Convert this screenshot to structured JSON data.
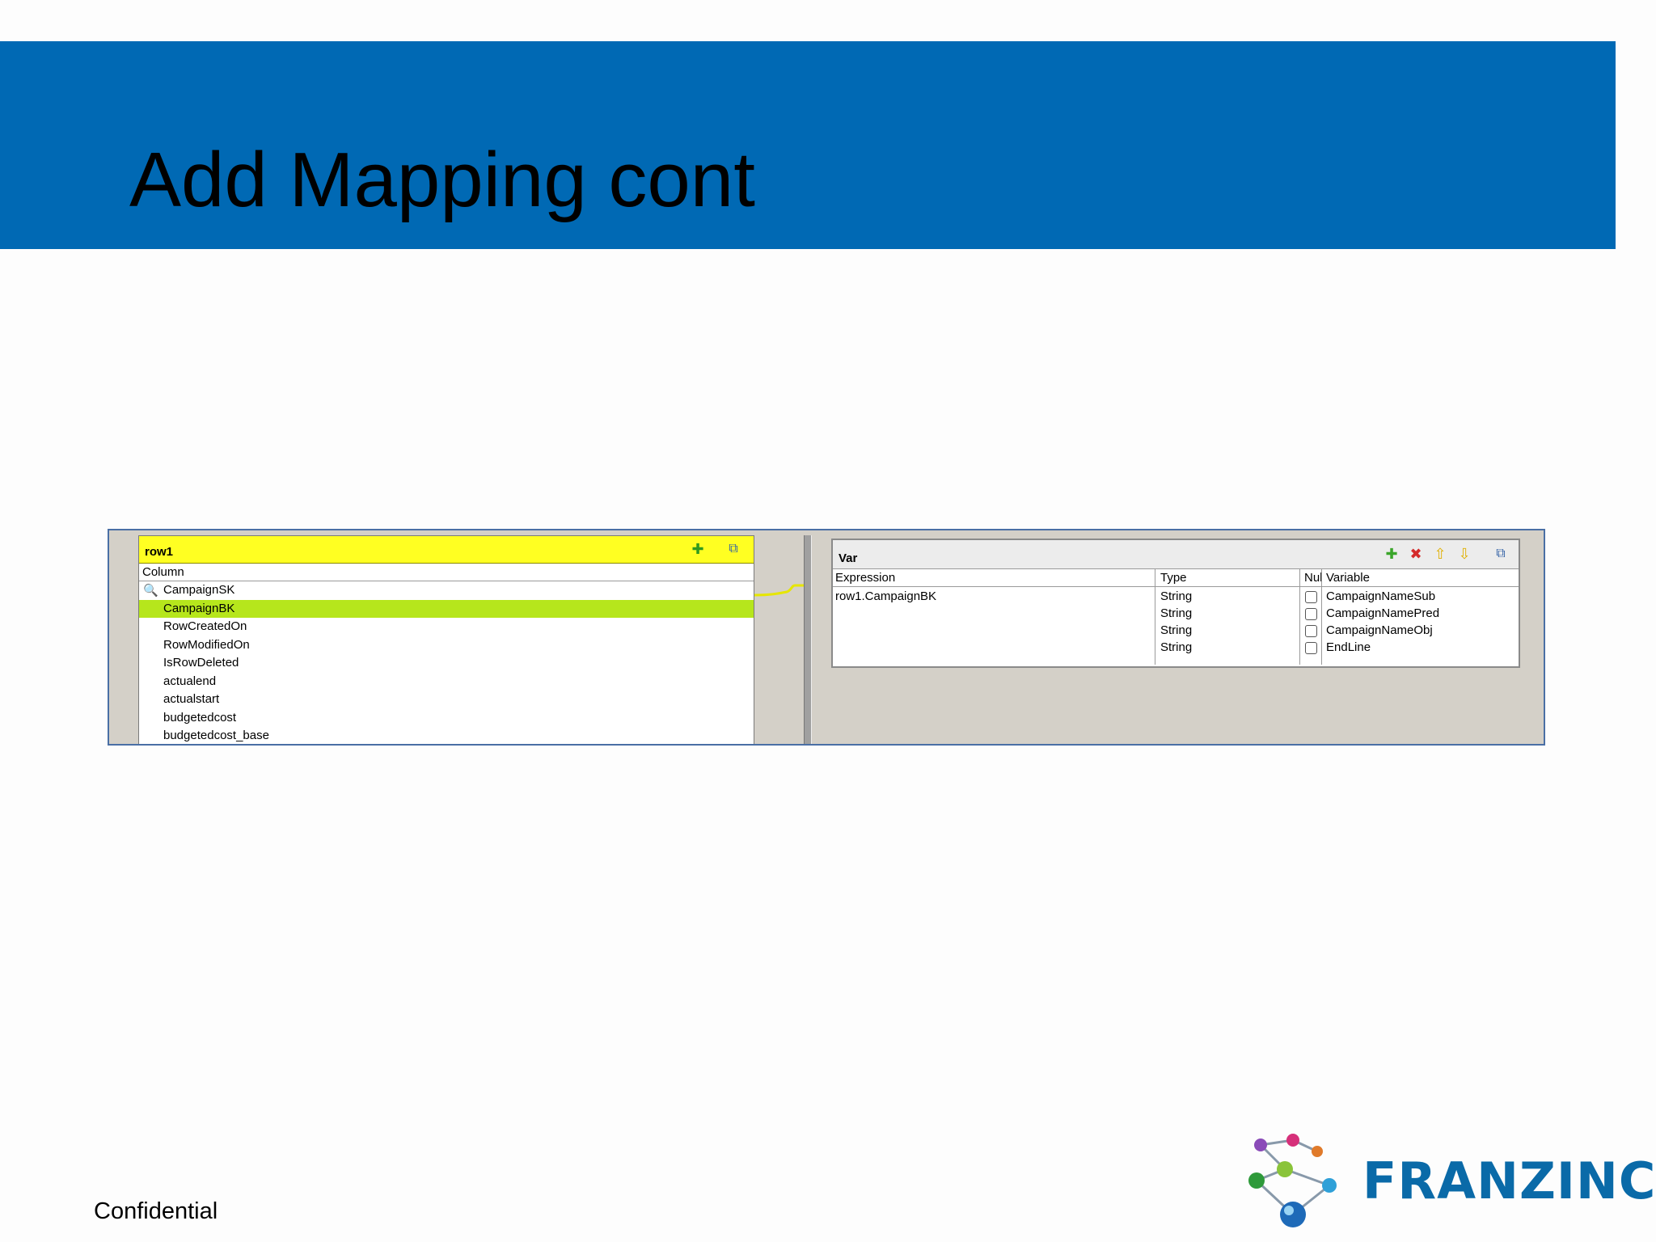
{
  "slide": {
    "title": "Add Mapping cont",
    "footer": "Confidential",
    "colors": {
      "banner": "#0069b4",
      "row_header": "#ffff22",
      "selected_row": "#b6e61c"
    }
  },
  "input_table": {
    "name": "row1",
    "column_header": "Column",
    "rows": [
      {
        "label": "CampaignSK",
        "key": true,
        "selected": false
      },
      {
        "label": "CampaignBK",
        "key": false,
        "selected": true
      },
      {
        "label": "RowCreatedOn",
        "key": false,
        "selected": false
      },
      {
        "label": "RowModifiedOn",
        "key": false,
        "selected": false
      },
      {
        "label": "IsRowDeleted",
        "key": false,
        "selected": false
      },
      {
        "label": "actualend",
        "key": false,
        "selected": false
      },
      {
        "label": "actualstart",
        "key": false,
        "selected": false
      },
      {
        "label": "budgetedcost",
        "key": false,
        "selected": false
      },
      {
        "label": "budgetedcost_base",
        "key": false,
        "selected": false
      }
    ],
    "toolbar_icons": [
      "add-icon",
      "expand-window-icon"
    ]
  },
  "var_table": {
    "name": "Var",
    "headers": {
      "expression": "Expression",
      "type": "Type",
      "nullable": "Nul",
      "variable": "Variable"
    },
    "rows": [
      {
        "expression": "row1.CampaignBK",
        "type": "String",
        "nullable": false,
        "variable": "CampaignNameSub"
      },
      {
        "expression": "",
        "type": "String",
        "nullable": false,
        "variable": "CampaignNamePred"
      },
      {
        "expression": "",
        "type": "String",
        "nullable": false,
        "variable": "CampaignNameObj"
      },
      {
        "expression": "",
        "type": "String",
        "nullable": false,
        "variable": "EndLine"
      }
    ],
    "toolbar_icons": [
      "plus-icon",
      "delete-icon",
      "arrow-up-icon",
      "arrow-down-icon",
      "expand-window-icon"
    ]
  },
  "logo": {
    "text": "FRANZINC."
  }
}
